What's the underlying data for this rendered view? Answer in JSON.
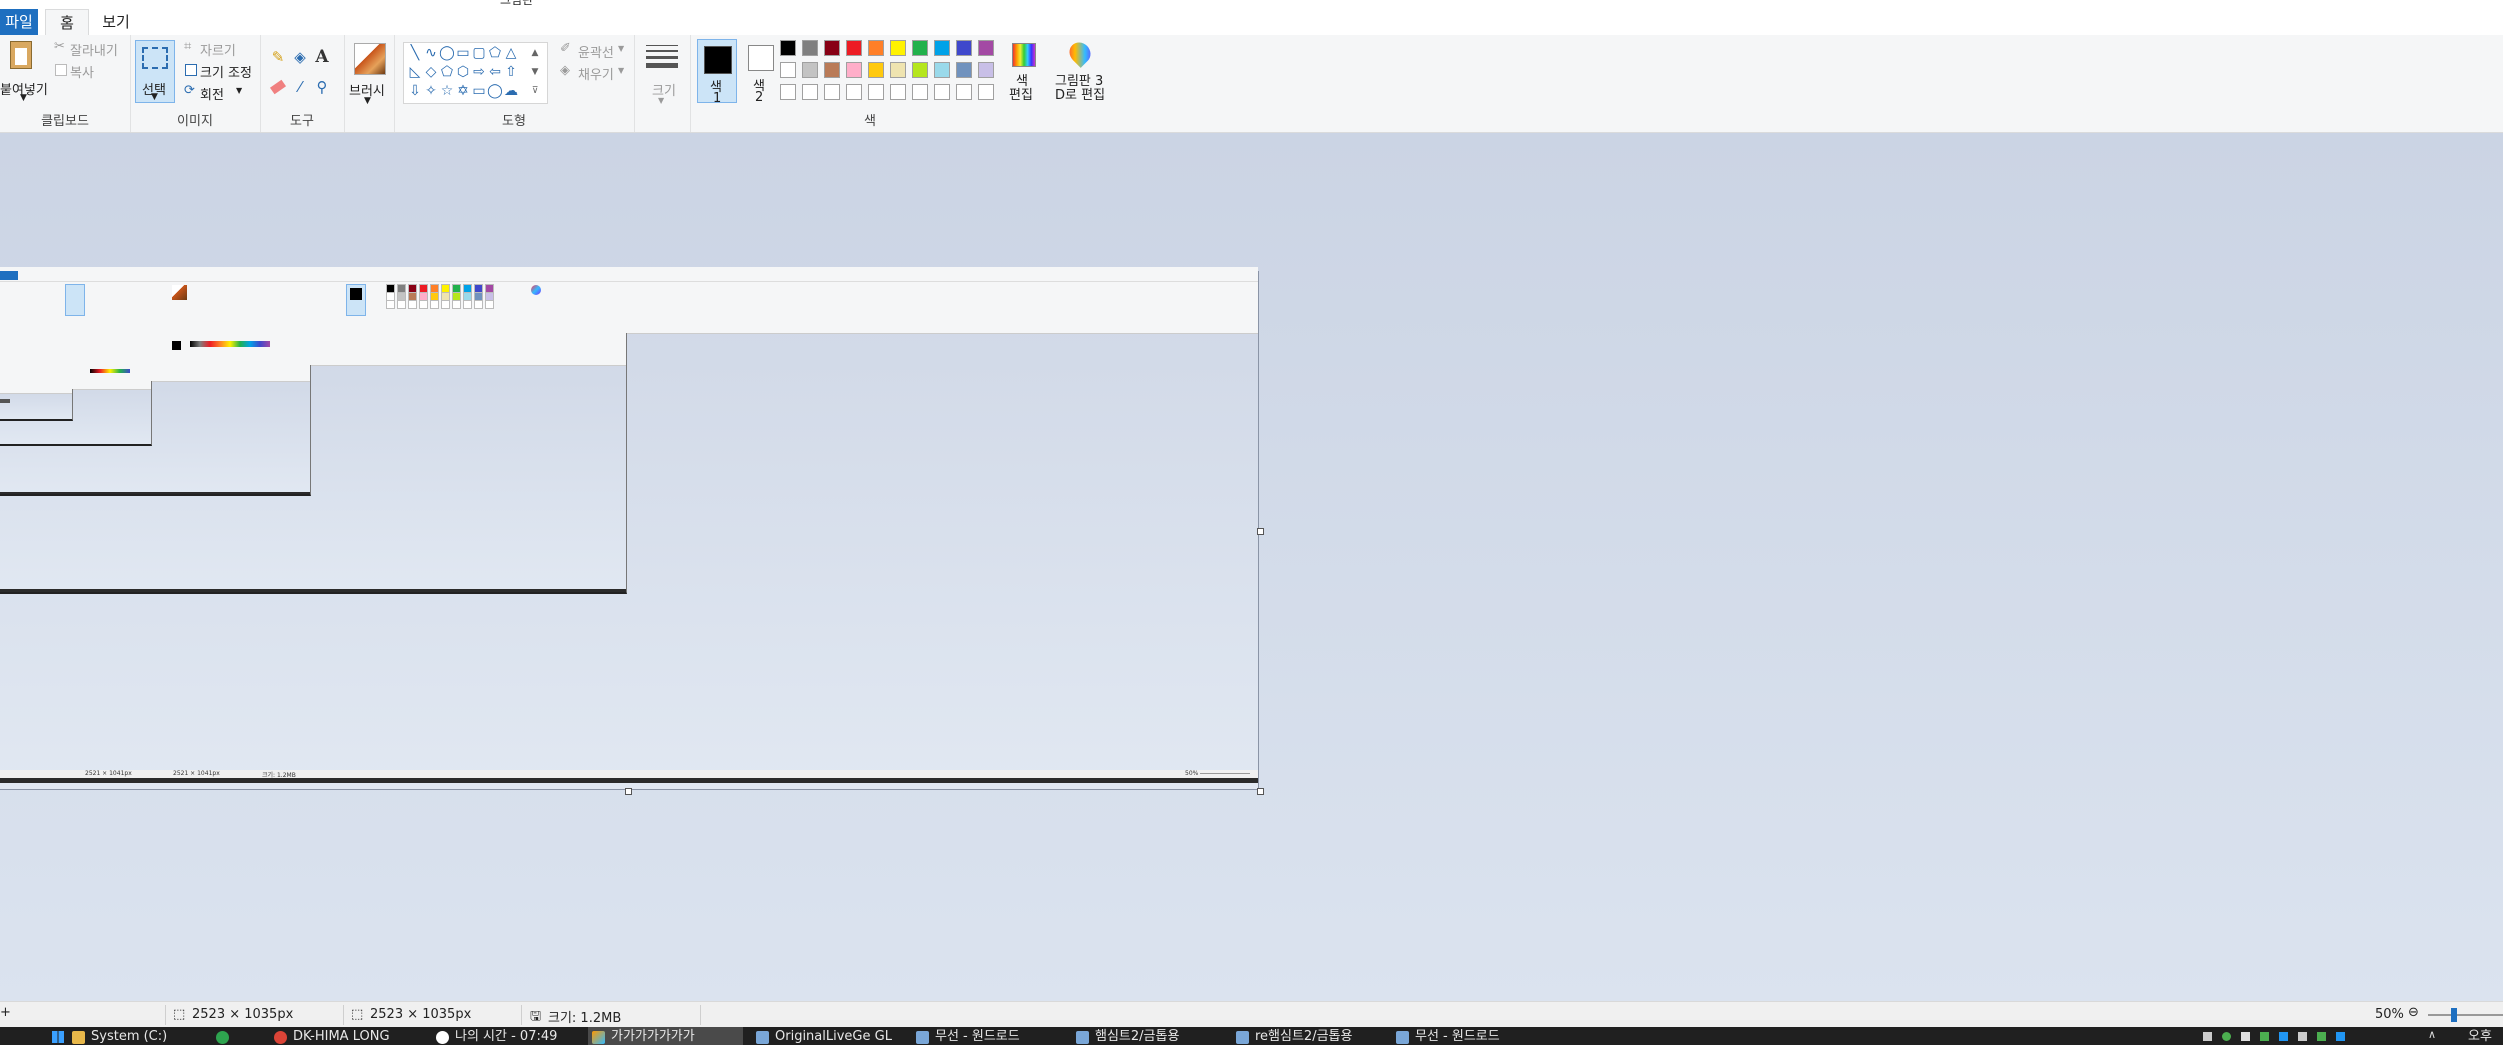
{
  "window": {
    "title_fragment": "그림판"
  },
  "tabs": {
    "file": "파일",
    "home": "홈",
    "view": "보기"
  },
  "clipboard": {
    "paste": "붙여넣기",
    "cut": "잘라내기",
    "copy": "복사",
    "label": "클립보드"
  },
  "image": {
    "select": "선택",
    "crop": "자르기",
    "resize": "크기 조정",
    "rotate": "회전",
    "label": "이미지"
  },
  "tools": {
    "label": "도구",
    "text_icon": "A"
  },
  "brush": {
    "label": "브러시"
  },
  "shapes": {
    "label": "도형",
    "outline": "윤곽선",
    "fill": "채우기"
  },
  "size": {
    "label": "크기"
  },
  "colors": {
    "color1_line1": "색",
    "color1_line2": "1",
    "color2_line1": "색",
    "color2_line2": "2",
    "edit_line1": "색",
    "edit_line2": "편집",
    "paint3d_line1": "그림판 3",
    "paint3d_line2": "D로 편집",
    "label": "색",
    "palette_row1": [
      "#000000",
      "#7f7f7f",
      "#880015",
      "#ed1c24",
      "#ff7f27",
      "#fff200",
      "#22b14c",
      "#00a2e8",
      "#3f48cc",
      "#a349a4"
    ],
    "palette_row2": [
      "#ffffff",
      "#c3c3c3",
      "#b97a57",
      "#ffaec9",
      "#ffc90e",
      "#efe4b0",
      "#b5e61d",
      "#99d9ea",
      "#7092be",
      "#c8bfe7"
    ]
  },
  "status": {
    "cursor_dim": "2523 × 1035px",
    "selection_dim": "2523 × 1035px",
    "file_size": "크기: 1.2MB",
    "zoom": "50%"
  },
  "taskbar": {
    "items": [
      "System (C:)",
      "DK-HIMA LONG",
      "나의 시간 - 07:49",
      "가가가가가가가",
      "OriginalLiveGe GL",
      "무선 - 원드로드",
      "햄심트2/금톱용",
      "re햄심트2/금톱용",
      "무선 - 원드로드"
    ],
    "clock": "오후"
  },
  "nested": {
    "status_dim1": "2521 × 1041px",
    "status_dim2": "2521 × 1041px",
    "file_size": "크기: 1.2MB",
    "zoom": "50%"
  }
}
